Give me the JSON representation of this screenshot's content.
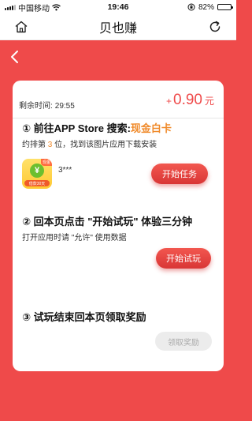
{
  "status_bar": {
    "carrier": "中国移动",
    "time": "19:46",
    "battery": "82%",
    "battery_level": 0.82
  },
  "nav": {
    "title": "贝也赚",
    "icons": [
      "home-icon",
      "refresh-icon"
    ]
  },
  "header": {
    "back_icon": "chevron-left-icon"
  },
  "card": {
    "remaining_label": "剩余时间:",
    "remaining_value": "29:55",
    "reward_plus": "+",
    "reward_amount": "0.90",
    "reward_unit": "元",
    "steps": [
      {
        "title_prefix": "① 前往APP Store 搜索:",
        "title_highlight": "现金白卡",
        "desc_prefix": "约排第",
        "desc_rank": "3",
        "desc_suffix": "位，找到该图片应用下载安装",
        "app_name": "3***",
        "app_icon_symbol": "¥",
        "app_badge_top": "现金",
        "app_badge_bottom": "借款30天",
        "button": "开始任务"
      },
      {
        "title": "② 回本页点击 \"开始试玩\" 体验三分钟",
        "desc": "打开应用时请 \"允许\" 使用数据",
        "button": "开始试玩"
      },
      {
        "title": "③ 试玩结束回本页领取奖励",
        "button": "领取奖励"
      }
    ]
  },
  "colors": {
    "brand_red": "#ef4a4a",
    "accent_orange": "#f08a2a",
    "disabled_gray": "#ececec"
  }
}
